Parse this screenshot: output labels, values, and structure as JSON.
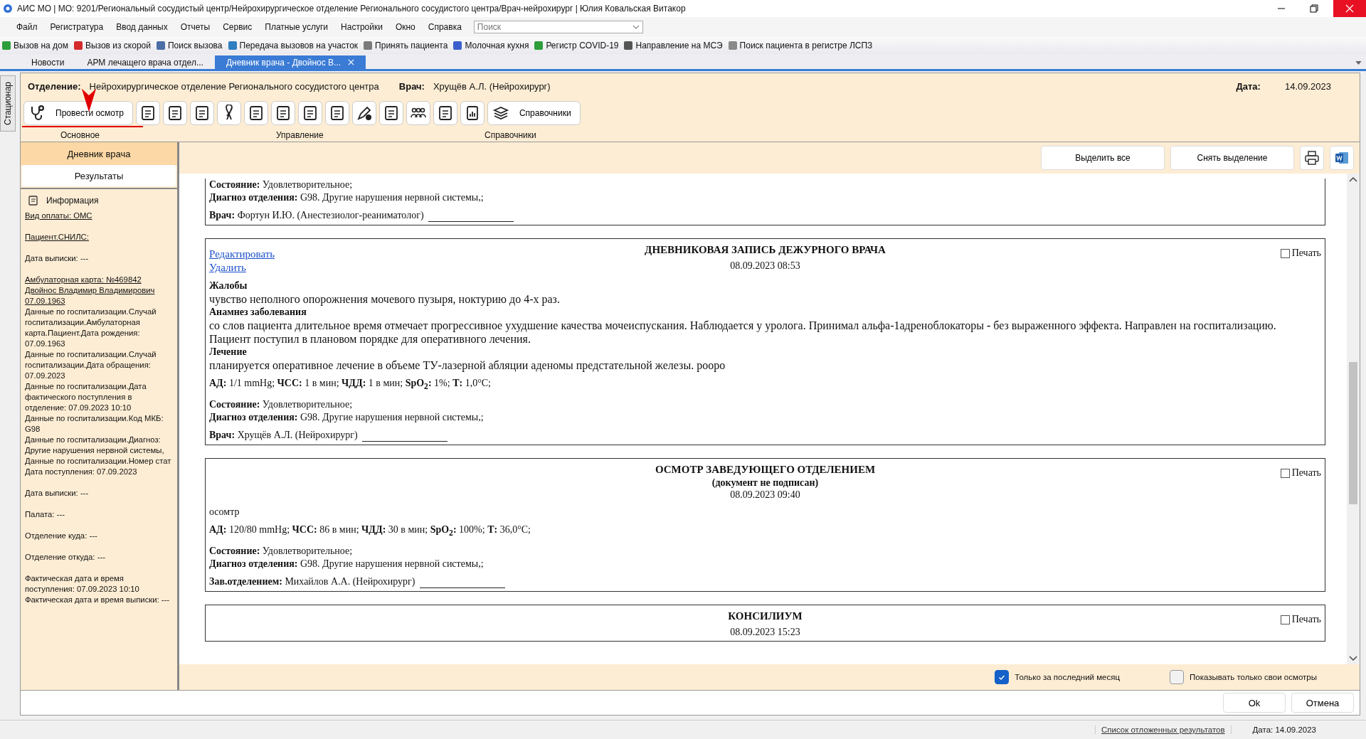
{
  "window": {
    "title": "АИС МО | МО: 9201/Региональный сосудистый центр/Нейрохирургическое отделение Регионального сосудистого центра/Врач-нейрохирург | Юлия Ковальская Витакор"
  },
  "menu": [
    "Файл",
    "Регистратура",
    "Ввод данных",
    "Отчеты",
    "Сервис",
    "Платные услуги",
    "Настройки",
    "Окно",
    "Справка"
  ],
  "search": {
    "placeholder": "Поиск"
  },
  "quick_toolbar": [
    {
      "label": "Вызов на дом",
      "color": "#2e9e3a"
    },
    {
      "label": "Вызов из скорой",
      "color": "#d42a2a"
    },
    {
      "label": "Поиск вызова",
      "color": "#4a6fa5"
    },
    {
      "label": "Передача вызовов на участок",
      "color": "#2f7fc1"
    },
    {
      "label": "Принять пациента",
      "color": "#7a7a7a"
    },
    {
      "label": "Молочная кухня",
      "color": "#3a5fcd"
    },
    {
      "label": "Регистр COVID-19",
      "color": "#2e9e3a"
    },
    {
      "label": "Направление на МСЭ",
      "color": "#555555"
    },
    {
      "label": "Поиск пациента в регистре ЛСПЗ",
      "color": "#8a8a8a"
    }
  ],
  "tabs": [
    {
      "label": "Новости",
      "selected": false
    },
    {
      "label": "АРМ лечащего врача отдел...",
      "selected": false
    },
    {
      "label": "Дневник врача - Двойнос В...",
      "selected": true
    }
  ],
  "side_tab": "Стационар",
  "header": {
    "department_label": "Отделение:",
    "department": "Нейрохирургическое отделение Регионального сосудистого центра",
    "doctor_label": "Врач:",
    "doctor": "Хрущёв А.Л. (Нейрохирург)",
    "date_label": "Дата:",
    "date": "14.09.2023"
  },
  "ribbon": {
    "primary_button": "Провести осмотр",
    "references_button": "Справочники",
    "groups": [
      "Основное",
      "Управление",
      "Справочники"
    ]
  },
  "nav": [
    {
      "label": "Дневник врача",
      "selected": true
    },
    {
      "label": "Результаты",
      "selected": false
    }
  ],
  "info": {
    "title": "Информация",
    "blocks": [
      [
        {
          "text": "Вид оплаты: ОМС",
          "link": true
        }
      ],
      [
        {
          "text": "Пациент.СНИЛС:",
          "link": true
        }
      ],
      [
        {
          "text": "Дата выписки: ---",
          "link": false
        }
      ],
      [
        {
          "text": "Амбулаторная карта: №469842 Двойнос Владимир Владимирович 07.09.1963",
          "link": true
        },
        {
          "text": "Данные по госпитализации.Случай госпитализации.Амбулаторная карта.Пациент.Дата рождения: 07.09.1963",
          "link": false
        },
        {
          "text": "Данные по госпитализации.Случай госпитализации.Дата обращения: 07.09.2023",
          "link": false
        },
        {
          "text": "Данные по госпитализации.Дата фактического поступления в отделение: 07.09.2023 10:10",
          "link": false
        },
        {
          "text": "Данные по госпитализации.Код МКБ: G98",
          "link": false
        },
        {
          "text": "Данные по госпитализации.Диагноз: Другие нарушения нервной системы,",
          "link": false
        },
        {
          "text": "Данные по госпитализации.Номер стат",
          "link": false
        },
        {
          "text": "Дата поступления: 07.09.2023",
          "link": false
        }
      ],
      [
        {
          "text": "Дата выписки: ---",
          "link": false
        }
      ],
      [
        {
          "text": "Палата: ---",
          "link": false
        }
      ],
      [
        {
          "text": "Отделение куда: ---",
          "link": false
        }
      ],
      [
        {
          "text": "Отделение откуда: ---",
          "link": false
        }
      ],
      [
        {
          "text": "Фактическая дата и время поступления: 07.09.2023 10:10",
          "link": false
        },
        {
          "text": "Фактическая дата и время выписки: ---",
          "link": false
        }
      ]
    ]
  },
  "actions": [
    "Выделить все",
    "Снять выделение"
  ],
  "entries": [
    {
      "cut_top": true,
      "sections": [
        [
          {
            "kind": "row",
            "text": "**Состояние:** Удовлетворительное;"
          },
          {
            "kind": "row",
            "text": "**Диагноз отделения:** G98. Другие нарушения нервной системы,;"
          }
        ],
        [
          {
            "kind": "signature",
            "text": "**Врач:** Фортун И.Ю. (Анестезиолог-реаниматолог)"
          }
        ]
      ]
    },
    {
      "cut_top": false,
      "links": [
        "Редактировать",
        "Удалить"
      ],
      "title": "ДНЕВНИКОВАЯ ЗАПИСЬ ДЕЖУРНОГО ВРАЧА",
      "date": "08.09.2023 08:53",
      "print": {
        "label": "Печать",
        "checked": false
      },
      "sections": [
        [
          {
            "kind": "heading",
            "text": "Жалобы"
          },
          {
            "kind": "text",
            "text": "чувство неполного опорожнения мочевого пузыря, ноктурию до 4-х раз."
          },
          {
            "kind": "heading",
            "text": "Анамнез заболевания"
          },
          {
            "kind": "text",
            "text": "со слов пациента длительное время отмечает прогрессивное ухудшение качества мочеиспускания. Наблюдается у уролога. Принимал альфа-1адреноблокаторы **-** без выраженного эффекта. Направлен на госпитализацию. Пациент поступил в плановом порядке для оперативного лечения."
          },
          {
            "kind": "heading",
            "text": "Лечение"
          },
          {
            "kind": "text",
            "text": "планируется оперативное лечение в объеме ТУ-лазерной абляции аденомы предстательной железы. рооро"
          }
        ],
        [
          {
            "kind": "row",
            "text": "**АД:** 1/1 mmHg; **ЧСС:** 1 в мин; **ЧДД:** 1 в мин; **SpO$_{2}$:** 1%; **Т:** 1,0°C;"
          }
        ],
        [
          {
            "kind": "row",
            "text": "**Состояние:** Удовлетворительное;"
          },
          {
            "kind": "row",
            "text": "**Диагноз отделения:** G98. Другие нарушения нервной системы,;"
          }
        ],
        [
          {
            "kind": "signature",
            "text": "**Врач:** Хрущёв А.Л. (Нейрохирург)"
          }
        ]
      ]
    },
    {
      "cut_top": false,
      "title": "ОСМОТР ЗАВЕДУЮЩЕГО ОТДЕЛЕНИЕМ",
      "subtitle": "(документ не подписан)",
      "date": "08.09.2023 09:40",
      "print": {
        "label": "Печать",
        "checked": false
      },
      "sections": [
        [
          {
            "kind": "row",
            "text": "осомтр"
          }
        ],
        [
          {
            "kind": "row",
            "text": "**АД:** 120/80 mmHg; **ЧСС:** 86 в мин; **ЧДД:** 30 в мин; **SpO$_{2}$:** 100%; **Т:** 36,0°C;"
          }
        ],
        [
          {
            "kind": "row",
            "text": "**Состояние:** Удовлетворительное;"
          },
          {
            "kind": "row",
            "text": "**Диагноз отделения:** G98. Другие нарушения нервной системы,;"
          }
        ],
        [
          {
            "kind": "signature",
            "text": "**Зав.отделением:** Михайлов А.А. (Нейрохирург)"
          }
        ]
      ]
    },
    {
      "cut_top": false,
      "title": "КОНСИЛИУМ",
      "date": "08.09.2023 15:23",
      "print": {
        "label": "Печать",
        "checked": false
      }
    }
  ],
  "filters": [
    {
      "label": "Только за последний месяц",
      "checked": true
    },
    {
      "label": "Показывать только свои осмотры",
      "checked": false
    }
  ],
  "dialog_buttons": [
    "Ok",
    "Отмена"
  ],
  "status_bar": {
    "link": "Список отложенных результатов",
    "date": "Дата: 14.09.2023"
  }
}
